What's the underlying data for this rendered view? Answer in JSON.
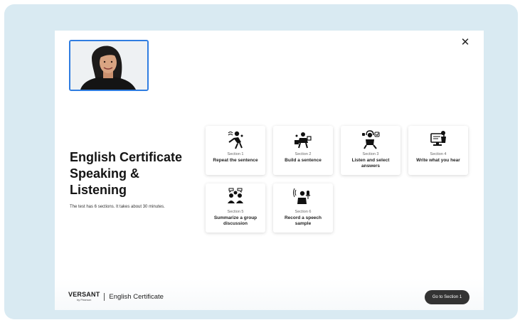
{
  "header": {
    "close_icon": "close-icon"
  },
  "main": {
    "title_lines": [
      "English Certificate",
      "Speaking &",
      "Listening"
    ],
    "description": "The test has 6 sections. It takes about 30 minutes."
  },
  "sections": [
    {
      "number": "Section 1",
      "name": "Repeat the sentence",
      "icon": "speaking-person-icon"
    },
    {
      "number": "Section 2",
      "name": "Build a sentence",
      "icon": "puzzle-build-icon"
    },
    {
      "number": "Section 3",
      "name": "Listen and select answers",
      "icon": "listen-select-icon"
    },
    {
      "number": "Section 4",
      "name": "Write what you hear",
      "icon": "write-monitor-icon"
    },
    {
      "number": "Section 5",
      "name": "Summarize a group discussion",
      "icon": "group-discussion-icon"
    },
    {
      "number": "Section 6",
      "name": "Record a speech sample",
      "icon": "record-speech-icon"
    }
  ],
  "footer": {
    "brand": "VERSANT",
    "brand_sub": "by Pearson",
    "product": "English Certificate",
    "go_button_label": "Go to Section 1"
  },
  "colors": {
    "frame_bg": "#d9eaf2",
    "webcam_border": "#2f7de1",
    "button_bg": "#333333"
  }
}
